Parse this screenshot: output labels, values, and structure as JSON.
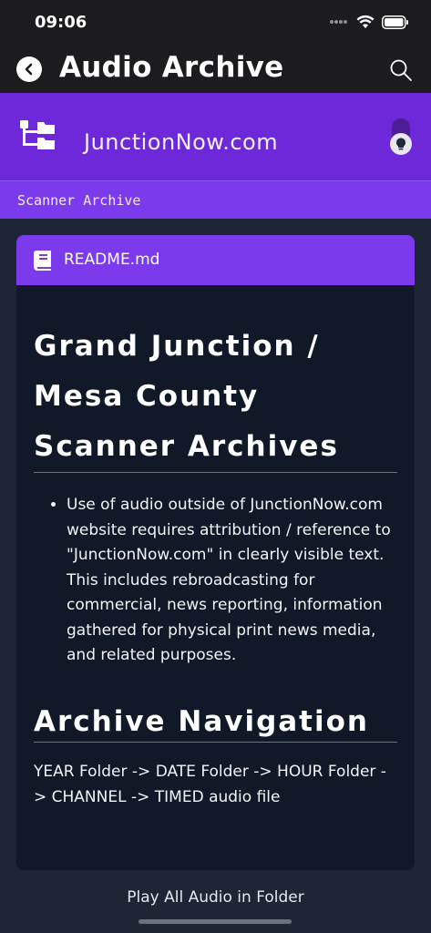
{
  "status": {
    "time": "09:06"
  },
  "app_bar": {
    "title": "Audio Archive"
  },
  "site": {
    "name": "JunctionNow.com"
  },
  "breadcrumb": "Scanner Archive",
  "readme": {
    "filename": "README.md",
    "title": "Grand Junction / Mesa County Scanner Archives",
    "bullets": [
      "Use of audio outside of JunctionNow.com website requires attribution / reference to \"JunctionNow.com\" in clearly visible text. This includes rebroadcasting for commercial, news reporting, information gathered for physical print news media, and related purposes."
    ],
    "section_title": "Archive Navigation",
    "section_text": "YEAR Folder -> DATE Folder -> HOUR Folder -> CHANNEL -> TIMED audio file"
  },
  "play_all_label": "Play All Audio in Folder",
  "colors": {
    "app_bar_bg": "#1c1c1e",
    "header_purple": "#6d28d9",
    "accent_purple": "#7c3aed",
    "card_bg": "#111827",
    "page_bg": "#1e2636"
  }
}
